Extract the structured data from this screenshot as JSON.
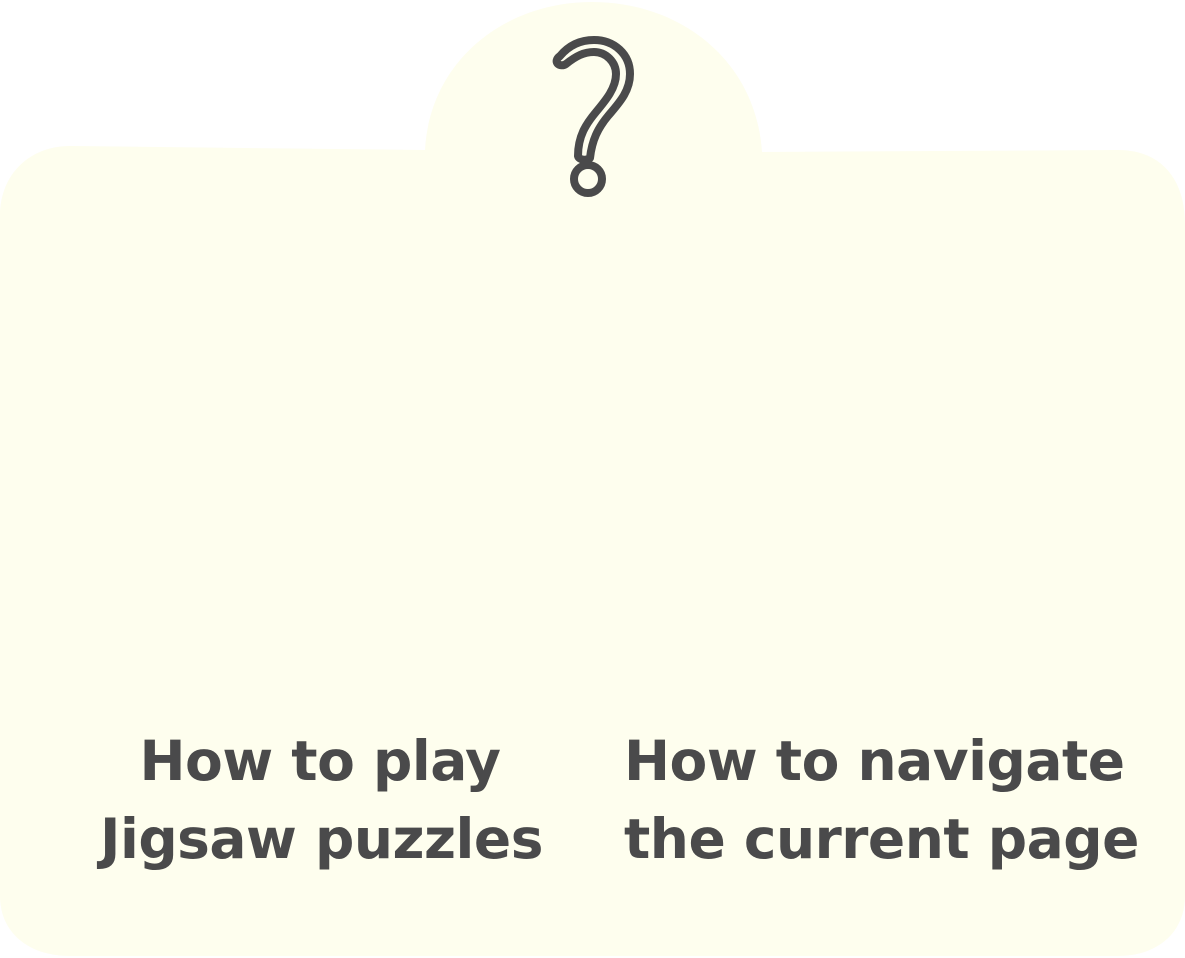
{
  "help_panel": {
    "icon": "question-mark-icon",
    "background_color": "#fefeee",
    "text_color": "#4a4a4b",
    "options": [
      {
        "line1": "How to play",
        "line2": "Jigsaw puzzles"
      },
      {
        "line1": "How to navigate",
        "line2": "the current page"
      }
    ]
  }
}
